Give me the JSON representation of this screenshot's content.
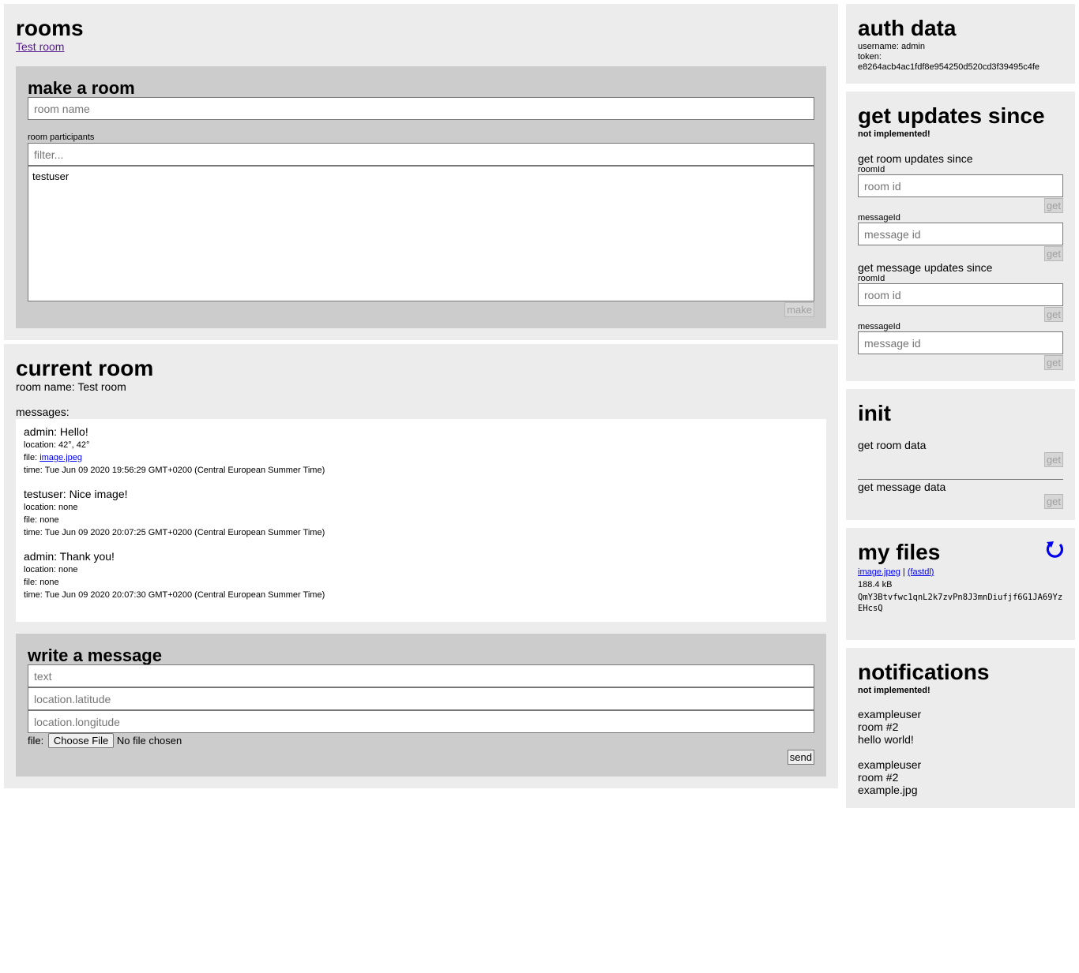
{
  "rooms": {
    "title": "rooms",
    "room_links": [
      "Test room"
    ],
    "make_room": {
      "title": "make a room",
      "room_name_placeholder": "room name",
      "participants_label": "room participants",
      "filter_placeholder": "filter...",
      "participants": [
        "testuser"
      ],
      "make_label": "make"
    }
  },
  "current_room": {
    "title": "current room",
    "room_name_line": "room name: Test room",
    "messages_label": "messages:",
    "messages": [
      {
        "head": "admin: Hello!",
        "location": "location: 42°, 42°",
        "file_prefix": "file: ",
        "file_link": "image.jpeg",
        "file_none": "",
        "time": "time: Tue Jun 09 2020 19:56:29 GMT+0200 (Central European Summer Time)"
      },
      {
        "head": "testuser: Nice image!",
        "location": "location: none",
        "file_prefix": "file: ",
        "file_link": "",
        "file_none": "none",
        "time": "time: Tue Jun 09 2020 20:07:25 GMT+0200 (Central European Summer Time)"
      },
      {
        "head": "admin: Thank you!",
        "location": "location: none",
        "file_prefix": "file: ",
        "file_link": "",
        "file_none": "none",
        "time": "time: Tue Jun 09 2020 20:07:30 GMT+0200 (Central European Summer Time)"
      }
    ],
    "write": {
      "title": "write a message",
      "text_placeholder": "text",
      "lat_placeholder": "location.latitude",
      "lon_placeholder": "location.longitude",
      "file_label": "file:",
      "choose_file_label": "Choose File",
      "no_file_label": "No file chosen",
      "send_label": "send"
    }
  },
  "auth": {
    "title": "auth data",
    "username_line": "username: admin",
    "token_label": "token:",
    "token_value": "e8264acb4ac1fdf8e954250d520cd3f39495c4fe"
  },
  "updates": {
    "title": "get updates since",
    "note": "not implemented!",
    "room_section": {
      "title": "get room updates since",
      "room_id_label": "roomId",
      "room_id_placeholder": "room id",
      "message_id_label": "messageId",
      "message_id_placeholder": "message id",
      "get_label": "get"
    },
    "message_section": {
      "title": "get message updates since",
      "room_id_label": "roomId",
      "room_id_placeholder": "room id",
      "message_id_label": "messageId",
      "message_id_placeholder": "message id",
      "get_label": "get"
    }
  },
  "init": {
    "title": "init",
    "room_data_label": "get room data",
    "message_data_label": "get message data",
    "get_label": "get"
  },
  "files": {
    "title": "my files",
    "refresh_icon": "refresh-icon",
    "file_name": "image.jpeg",
    "separator": " | ",
    "fastdl_label": "(fastdl)",
    "size": "188.4 kB",
    "hash": "QmY3Btvfwc1qnL2k7zvPn8J3mnDiufjf6G1JA69YzEHcsQ"
  },
  "notifications": {
    "title": "notifications",
    "note": "not implemented!",
    "items": [
      {
        "user": "exampleuser",
        "room": "room #2",
        "text": "hello world!"
      },
      {
        "user": "exampleuser",
        "room": "room #2",
        "text": "example.jpg"
      }
    ]
  },
  "colors": {
    "panel_bg": "#ececec",
    "subpanel_bg": "#cccccc",
    "link_visited": "#551a8b",
    "link": "#0000ee",
    "refresh_icon": "#0000ee"
  }
}
